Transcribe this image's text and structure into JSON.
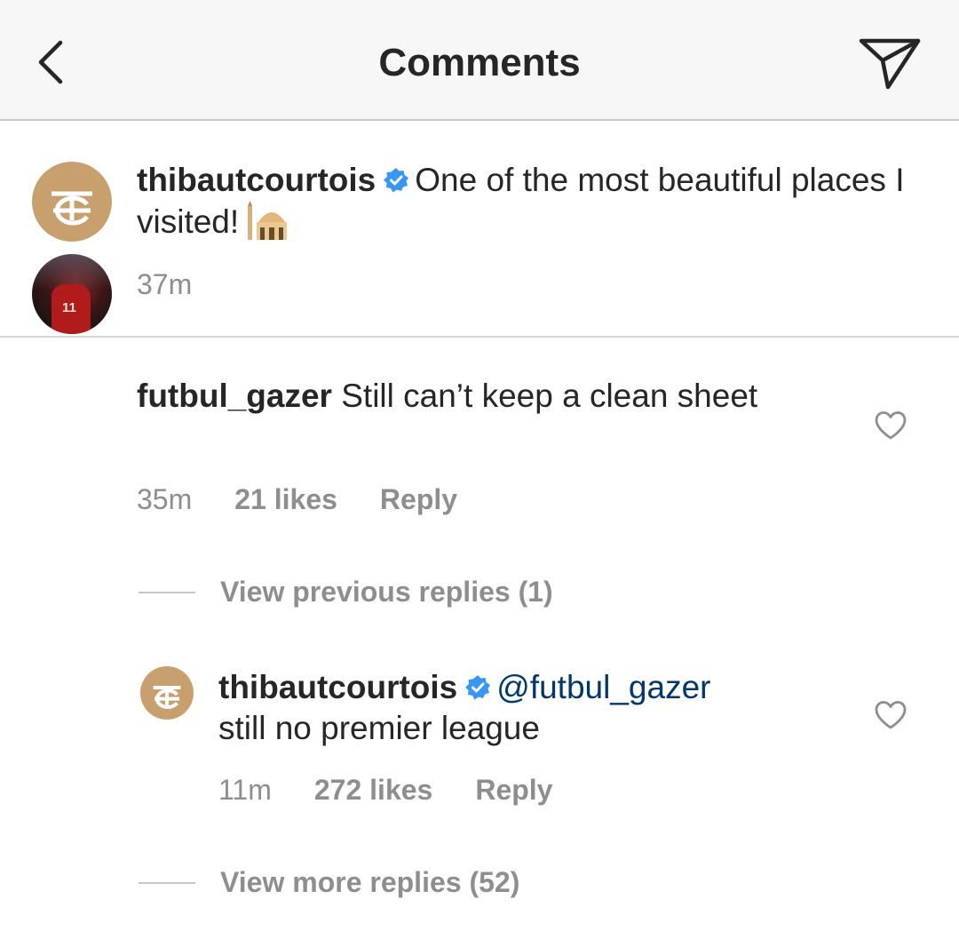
{
  "header": {
    "title": "Comments",
    "back_icon": "chevron-left-icon",
    "send_icon": "paper-plane-icon"
  },
  "caption": {
    "username": "thibautcourtois",
    "text": "One of the most beautiful places I visited!",
    "emoji": "mosque-emoji",
    "time": "37m"
  },
  "comments": [
    {
      "username": "futbul_gazer",
      "text": "Still can’t keep a clean sheet",
      "time": "35m",
      "likes": "21 likes",
      "reply_label": "Reply",
      "view_replies": "View previous replies (1)",
      "replies": [
        {
          "username": "thibautcourtois",
          "mention": "@futbul_gazer",
          "text": "still no premier league",
          "time": "11m",
          "likes": "272 likes",
          "reply_label": "Reply"
        }
      ],
      "view_more": "View more replies (52)"
    }
  ],
  "colors": {
    "verified_blue": "#3897f0",
    "meta_gray": "#8e8e8e",
    "mention_blue": "#00376b",
    "avatar_gold": "#c8a06e"
  }
}
